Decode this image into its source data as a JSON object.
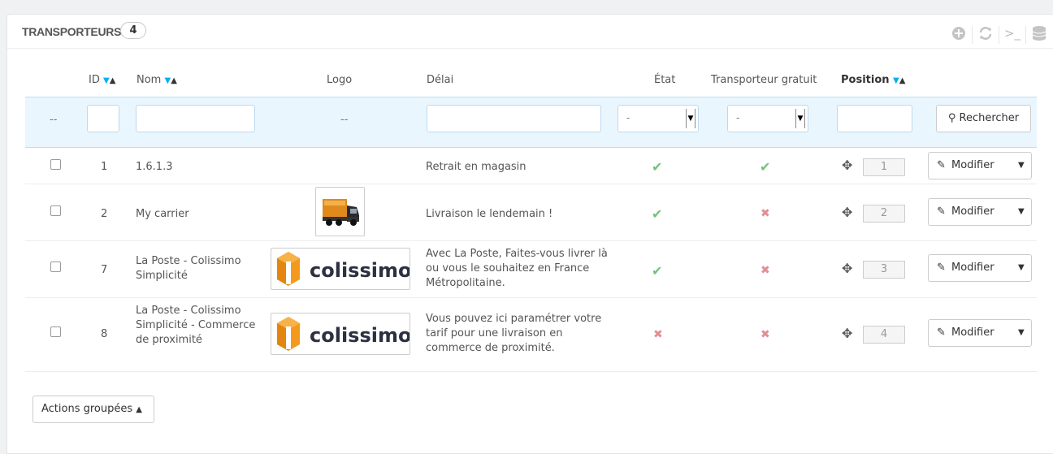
{
  "panel": {
    "title": "TRANSPORTEURS",
    "count": "4",
    "toolbar": [
      "add-icon",
      "refresh-icon",
      "sql-icon",
      "database-icon"
    ]
  },
  "headers": {
    "id": "ID",
    "name": "Nom",
    "logo": "Logo",
    "delay": "Délai",
    "state": "État",
    "free": "Transporteur gratuit",
    "position": "Position"
  },
  "filters": {
    "id_placeholder": "--",
    "logo_placeholder": "--",
    "state_value": "-",
    "free_value": "-",
    "search_label": "Rechercher"
  },
  "rows": [
    {
      "id": "1",
      "name": "1.6.1.3",
      "delay": "Retrait en magasin",
      "state": "yes",
      "free": "yes",
      "position": "1",
      "edit": "Modifier",
      "logo": ""
    },
    {
      "id": "2",
      "name": "My carrier",
      "delay": "Livraison le lendemain !",
      "state": "yes",
      "free": "no",
      "position": "2",
      "edit": "Modifier",
      "logo": "truck"
    },
    {
      "id": "7",
      "name": "La Poste - Colissimo Simplicité",
      "delay": "Avec La Poste, Faites-vous livrer là ou vous le souhaitez en France Métropolitaine.",
      "state": "yes",
      "free": "no",
      "position": "3",
      "edit": "Modifier",
      "logo": "colissimo"
    },
    {
      "id": "8",
      "name": "La Poste - Colissimo Simplicité - Commerce de proximité",
      "delay": "Vous pouvez ici paramétrer votre tarif pour une livraison en commerce de proximité.",
      "state": "no",
      "free": "no",
      "position": "4",
      "edit": "Modifier",
      "logo": "colissimo"
    }
  ],
  "logo_text": "colissimo",
  "bulk_actions": "Actions groupées",
  "colors": {
    "ok": "#72c279",
    "ko": "#e08f95",
    "accent": "#00aff0",
    "filter_bg": "#eaf6fd"
  }
}
